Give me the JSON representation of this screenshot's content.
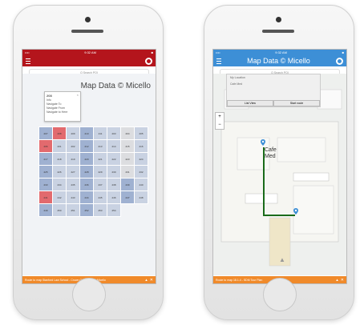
{
  "left": {
    "status": {
      "carrier": "•••• ",
      "time": "9:32 AM",
      "battery": "■"
    },
    "title": "",
    "search": "Q Search POI",
    "map_credit": "Map Data © Micello",
    "popup": {
      "title": "208",
      "close": "×",
      "items": [
        "Info",
        "Navigate To",
        "Navigate From",
        "Navigate to Here"
      ]
    },
    "bottom_bar": "Route to map Stanford Law School - Crown Quadrangle - Micello",
    "rooms": [
      "207",
      "208",
      "209",
      "210",
      "211",
      "203",
      "204",
      "205",
      "206",
      "201",
      "202",
      "212",
      "213",
      "214",
      "215",
      "216",
      "217",
      "218",
      "219",
      "220",
      "221",
      "222",
      "223",
      "224",
      "225",
      "226",
      "227",
      "228",
      "229",
      "230",
      "231",
      "232",
      "233",
      "234",
      "235",
      "236",
      "237",
      "238",
      "239",
      "240",
      "241",
      "242",
      "243",
      "244",
      "245",
      "246",
      "247",
      "248",
      "249",
      "250",
      "251",
      "252",
      "253",
      "254"
    ]
  },
  "right": {
    "status": {
      "carrier": "••••",
      "time": "9:32 AM",
      "battery": "■"
    },
    "title": "Map Data © Micello",
    "search": "Q Search POI",
    "dropdown": {
      "items": [
        "My Location",
        "Cafe Med"
      ],
      "buttons": [
        "List View",
        "Start route"
      ]
    },
    "cafe_label_1": "Cafe",
    "cafe_label_2": "Med",
    "bottom_bar": "Route to map 18.1.4 - SDM Tour Plan",
    "zoom": {
      "plus": "+",
      "minus": "−"
    },
    "up_arrow": "▲"
  },
  "colors": {
    "left_bar": "#b4151c",
    "right_bar": "#3d8fd6",
    "bottom_bar": "#f08a2a",
    "room": "#c9d2e2",
    "room_highlight": "#e26a6e",
    "route": "#1a6b1a"
  }
}
